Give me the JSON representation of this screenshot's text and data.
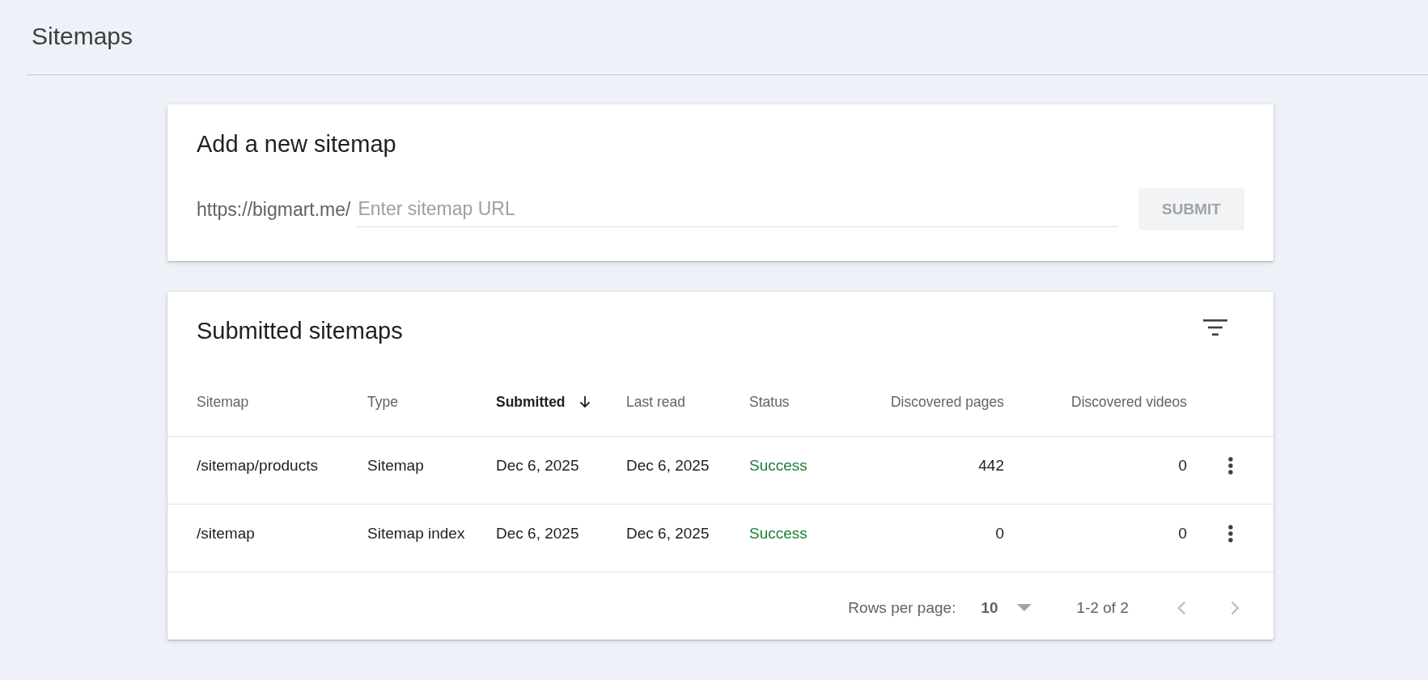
{
  "page": {
    "title": "Sitemaps"
  },
  "add_sitemap": {
    "title": "Add a new sitemap",
    "url_prefix": "https://bigmart.me/",
    "placeholder": "Enter sitemap URL",
    "submit": {
      "label": "SUBMIT",
      "disabled": true
    }
  },
  "submitted_sitemaps": {
    "title": "Submitted sitemaps",
    "table": {
      "columns": [
        {
          "label": "Sitemap",
          "sorted": false
        },
        {
          "label": "Type",
          "sorted": false
        },
        {
          "label": "Submitted",
          "sorted": true
        },
        {
          "label": "Last read",
          "sorted": false
        },
        {
          "label": "Status",
          "sorted": false
        },
        {
          "label": "Discovered pages",
          "sorted": false
        },
        {
          "label": "Discovered videos",
          "sorted": false
        }
      ],
      "rows": [
        {
          "cells": [
            "/sitemap/products",
            "Sitemap",
            "Dec 6, 2025",
            "Dec 6, 2025",
            "Success",
            "442",
            "0"
          ]
        },
        {
          "cells": [
            "/sitemap",
            "Sitemap index",
            "Dec 6, 2025",
            "Dec 6, 2025",
            "Success",
            "0",
            "0"
          ]
        }
      ]
    },
    "pagination": {
      "rows_per_page_label": "Rows per page:",
      "rows_per_page": "10",
      "range": "1-2 of 2",
      "previous": {
        "disabled": true
      },
      "next": {
        "disabled": true
      }
    }
  }
}
